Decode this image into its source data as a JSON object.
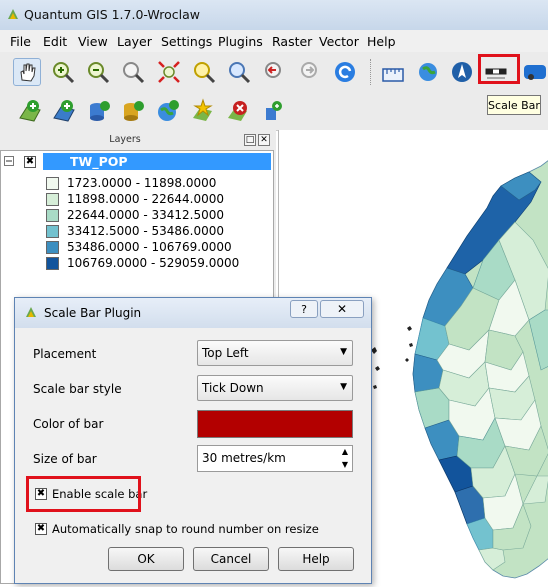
{
  "window": {
    "title": "Quantum GIS 1.7.0-Wroclaw"
  },
  "menu": [
    "File",
    "Edit",
    "View",
    "Layer",
    "Settings",
    "Plugins",
    "Raster",
    "Vector",
    "Help"
  ],
  "toolbar": {
    "tooltip": "Scale Bar"
  },
  "layers_panel": {
    "title": "Layers",
    "layer_name": "TW_POP",
    "legend": [
      {
        "label": "1723.0000 - 11898.0000",
        "color": "#f1f9ef"
      },
      {
        "label": "11898.0000 - 22644.0000",
        "color": "#d6eed8"
      },
      {
        "label": "22644.0000 - 33412.5000",
        "color": "#a9dbc6"
      },
      {
        "label": "33412.5000 - 53486.0000",
        "color": "#73c2cf"
      },
      {
        "label": "53486.0000 - 106769.0000",
        "color": "#3d8fc0"
      },
      {
        "label": "106769.0000 - 529059.0000",
        "color": "#12549c"
      }
    ]
  },
  "dialog": {
    "title": "Scale Bar Plugin",
    "help_symbol": "?",
    "placement_label": "Placement",
    "placement_value": "Top Left",
    "style_label": "Scale bar style",
    "style_value": "Tick Down",
    "color_label": "Color of bar",
    "bar_color": "#b30000",
    "size_label": "Size of bar",
    "size_value": "30 metres/km",
    "enable_label": "Enable scale bar",
    "enable_checked": true,
    "snap_label": "Automatically snap to round number on resize",
    "snap_checked": true,
    "ok_label": "OK",
    "cancel_label": "Cancel",
    "help_label": "Help"
  }
}
